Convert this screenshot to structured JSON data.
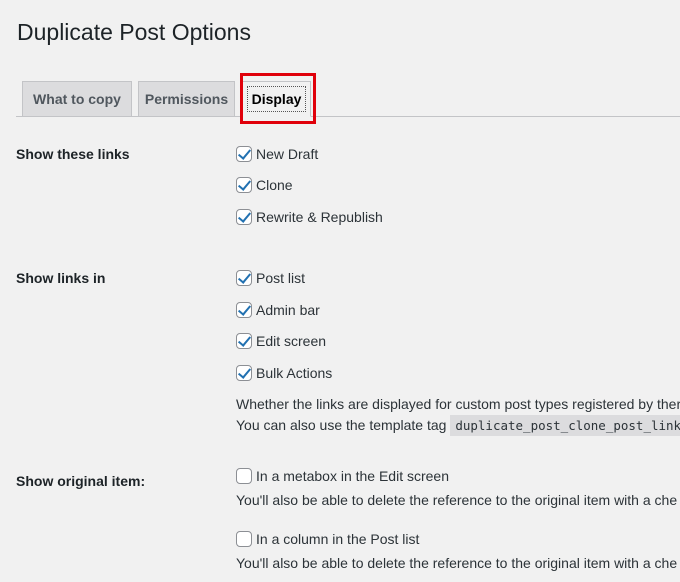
{
  "page": {
    "title": "Duplicate Post Options"
  },
  "tabs": [
    {
      "label": "What to copy"
    },
    {
      "label": "Permissions"
    },
    {
      "label": "Display"
    }
  ],
  "sections": {
    "show_links": {
      "label": "Show these links",
      "options": [
        {
          "label": "New Draft",
          "checked": true
        },
        {
          "label": "Clone",
          "checked": true
        },
        {
          "label": "Rewrite & Republish",
          "checked": true
        }
      ]
    },
    "show_links_in": {
      "label": "Show links in",
      "options": [
        {
          "label": "Post list",
          "checked": true
        },
        {
          "label": "Admin bar",
          "checked": true
        },
        {
          "label": "Edit screen",
          "checked": true
        },
        {
          "label": "Bulk Actions",
          "checked": true
        }
      ],
      "desc_line1": "Whether the links are displayed for custom post types registered by ther",
      "desc_line2_prefix": "You can also use the template tag",
      "desc_line2_code": "duplicate_post_clone_post_link("
    },
    "show_original": {
      "label": "Show original item:",
      "options": [
        {
          "label": "In a metabox in the Edit screen",
          "checked": false,
          "desc": "You'll also be able to delete the reference to the original item with a che"
        },
        {
          "label": "In a column in the Post list",
          "checked": false,
          "desc": "You'll also be able to delete the reference to the original item with a che"
        }
      ]
    }
  },
  "colors": {
    "accent": "#2271b1",
    "highlight": "#e0000a"
  }
}
